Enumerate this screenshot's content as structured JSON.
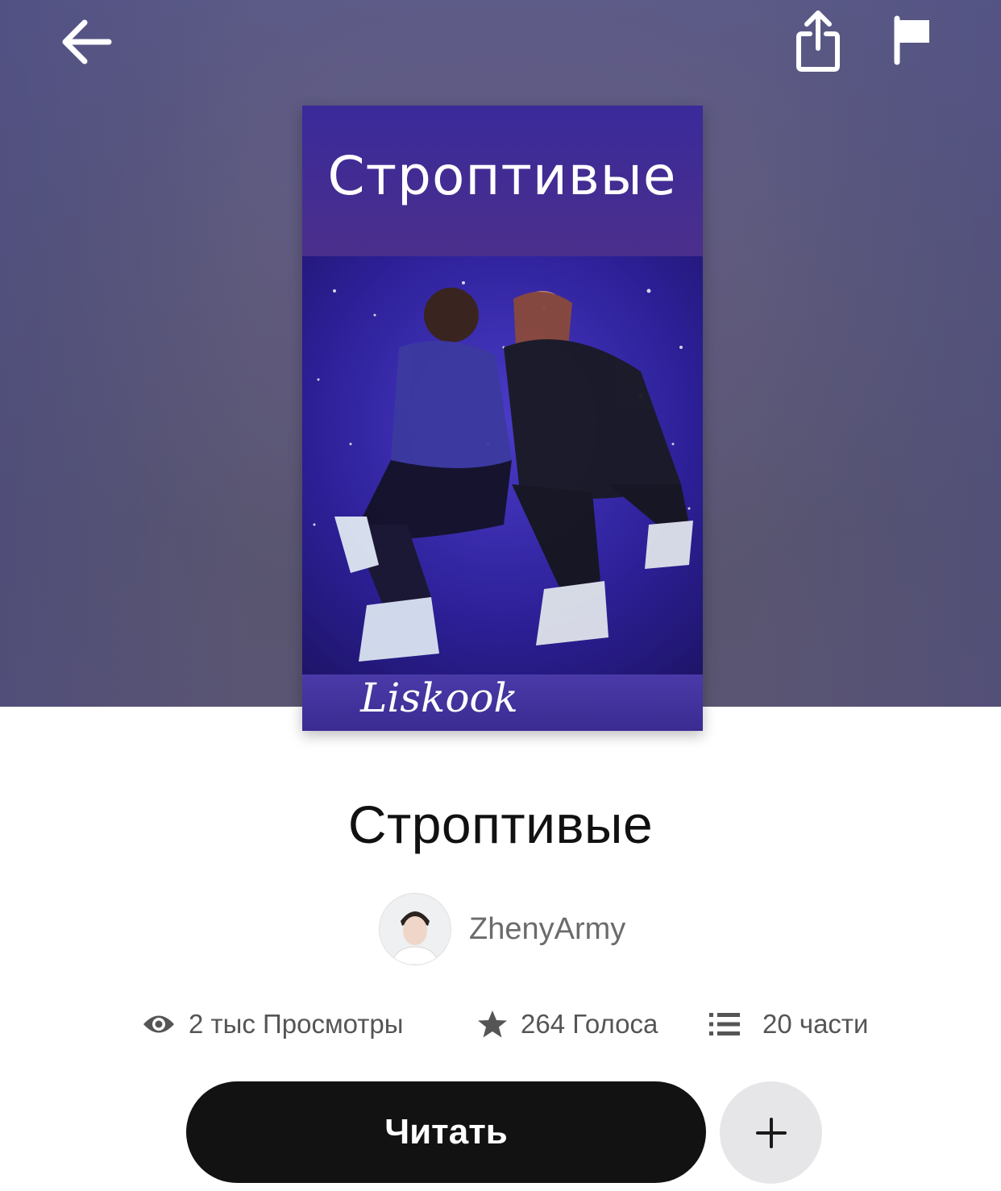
{
  "header": {
    "back_icon": "arrow-left-icon",
    "share_icon": "share-icon",
    "report_icon": "flag-icon"
  },
  "cover": {
    "title_text": "Строптивые",
    "subtitle_text": "Liskook"
  },
  "story": {
    "title": "Строптивые",
    "author": "ZhenyArmy"
  },
  "stats": {
    "views": "2 тыс Просмотры",
    "votes": "264 Голоса",
    "parts": "20 части"
  },
  "actions": {
    "read_label": "Читать",
    "add_icon": "plus-icon"
  },
  "colors": {
    "hero_bg": "#5a5878",
    "read_button_bg": "#121212",
    "add_button_bg": "#e6e6e8"
  }
}
